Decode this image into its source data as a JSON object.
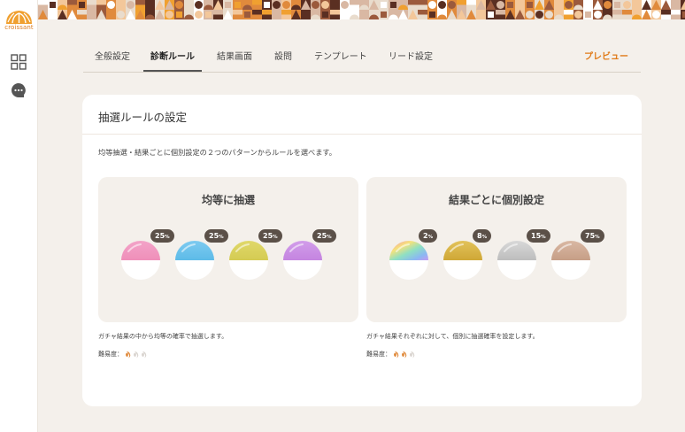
{
  "app": {
    "logo_text": "croissant"
  },
  "tabs": [
    {
      "label": "全般設定"
    },
    {
      "label": "診断ルール"
    },
    {
      "label": "結果画面"
    },
    {
      "label": "設問"
    },
    {
      "label": "テンプレート"
    },
    {
      "label": "リード設定"
    }
  ],
  "active_tab": "診断ルール",
  "preview_label": "プレビュー",
  "card": {
    "title": "抽選ルールの設定",
    "description": "均等抽選・結果ごとに個別設定の２つのパターンからルールを選べます。"
  },
  "options": [
    {
      "title": "均等に抽選",
      "capsules": [
        {
          "value": "25",
          "unit": "%",
          "color": "#ef8fb9",
          "color_top": "#f3a3c8"
        },
        {
          "value": "25",
          "unit": "%",
          "color": "#5dbbe8",
          "color_top": "#7dcaf0"
        },
        {
          "value": "25",
          "unit": "%",
          "color": "#d4cb52",
          "color_top": "#e0d86a"
        },
        {
          "value": "25",
          "unit": "%",
          "color": "#c484e0",
          "color_top": "#d29dea"
        }
      ],
      "note": "ガチャ結果の中から均等の確率で抽選します。",
      "difficulty_label": "難易度：",
      "difficulty_level": 1,
      "difficulty_max": 3
    },
    {
      "title": "結果ごとに個別設定",
      "capsules": [
        {
          "value": "2",
          "unit": "%",
          "color": "rainbow",
          "color_top": "rainbow"
        },
        {
          "value": "8",
          "unit": "%",
          "color": "#cfa736",
          "color_top": "#e2c25a"
        },
        {
          "value": "15",
          "unit": "%",
          "color": "#bdbdbd",
          "color_top": "#d8d8d8"
        },
        {
          "value": "75",
          "unit": "%",
          "color": "#c69e86",
          "color_top": "#d9b8a3"
        }
      ],
      "note": "ガチャ結果それぞれに対して、個別に抽選確率を設定します。",
      "difficulty_label": "難易度：",
      "difficulty_level": 2,
      "difficulty_max": 3
    }
  ],
  "colors": {
    "accent": "#e07b1a",
    "croissant_on": "#e08a3c",
    "croissant_off": "#d9d4cf"
  }
}
